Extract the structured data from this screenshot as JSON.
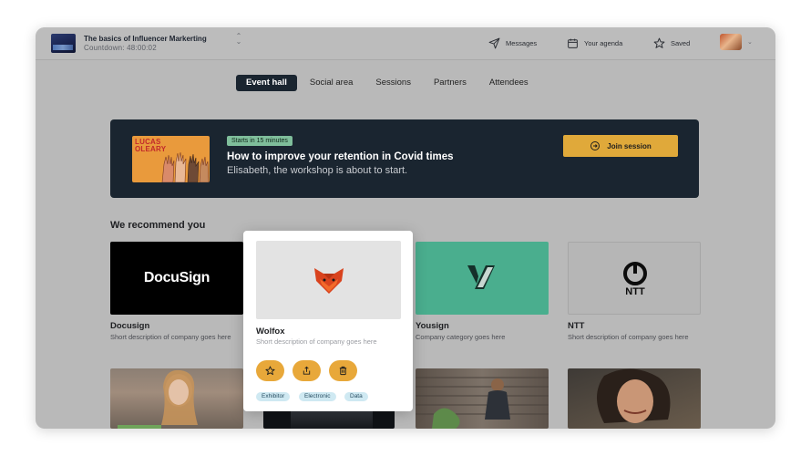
{
  "header": {
    "event_title": "The basics of Influencer Markerting",
    "countdown": "Countdown: 48:00:02",
    "messages_label": "Messages",
    "agenda_label": "Your agenda",
    "saved_label": "Saved"
  },
  "nav": {
    "tabs": [
      {
        "label": "Event hall",
        "active": true
      },
      {
        "label": "Social area"
      },
      {
        "label": "Sessions"
      },
      {
        "label": "Partners"
      },
      {
        "label": "Attendees"
      }
    ]
  },
  "banner": {
    "image_text_line1": "LUCAS",
    "image_text_line2": "OLEARY",
    "badge": "Starts in 15 minutes",
    "title": "How to improve your retention in Covid times",
    "subtitle": "Elisabeth, the workshop is about to start.",
    "join_label": "Join session"
  },
  "recommend": {
    "title": "We recommend you",
    "cards": [
      {
        "name": "Docusign",
        "desc": "Short description of company goes here",
        "logo_text": "DocuSign"
      },
      {
        "name": "Wolfox",
        "desc": "Short description of company goes here"
      },
      {
        "name": "Yousign",
        "desc": "Company category goes here"
      },
      {
        "name": "NTT",
        "desc": "Short description of company goes here",
        "logo_text": "NTT"
      }
    ]
  },
  "popup": {
    "name": "Wolfox",
    "desc": "Short description of company goes here",
    "tags": [
      "Exhibitor",
      "Electronic",
      "Data"
    ]
  },
  "colors": {
    "dark_navy": "#1a2530",
    "accent_gold": "#e0a93a",
    "badge_green": "#7fbe9b",
    "yousign_green": "#4aae8e",
    "tag_blue": "#cfe9f2"
  }
}
